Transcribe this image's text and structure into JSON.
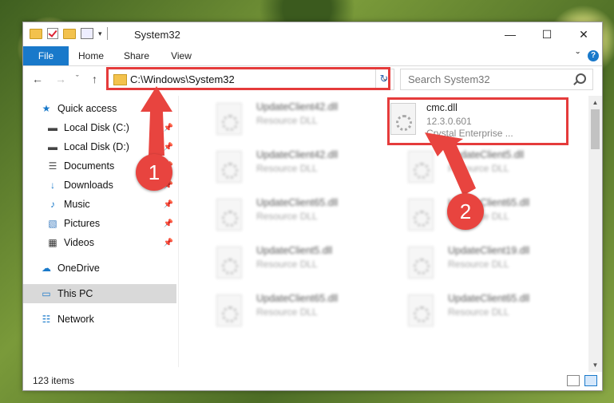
{
  "window": {
    "title": "System32",
    "minimize_glyph": "—",
    "maximize_glyph": "☐",
    "close_glyph": "✕"
  },
  "ribbon": {
    "tabs": [
      "File",
      "Home",
      "Share",
      "View"
    ],
    "expand_glyph": "ˇ",
    "help_glyph": "?"
  },
  "nav": {
    "back_glyph": "←",
    "forward_glyph": "→",
    "recent_glyph": "ˇ",
    "up_glyph": "↑",
    "address": "C:\\Windows\\System32",
    "refresh_glyph": "↻",
    "search_placeholder": "Search System32"
  },
  "sidebar": {
    "items": [
      {
        "label": "Quick access",
        "icon": "star-icon",
        "glyph": "★",
        "pinned": false
      },
      {
        "label": "Local Disk (C:)",
        "icon": "drive-icon",
        "glyph": "▬",
        "pinned": true
      },
      {
        "label": "Local Disk (D:)",
        "icon": "drive-icon",
        "glyph": "▬",
        "pinned": true
      },
      {
        "label": "Documents",
        "icon": "documents-icon",
        "glyph": "☰",
        "pinned": true
      },
      {
        "label": "Downloads",
        "icon": "downloads-icon",
        "glyph": "↓",
        "pinned": true
      },
      {
        "label": "Music",
        "icon": "music-icon",
        "glyph": "♪",
        "pinned": true
      },
      {
        "label": "Pictures",
        "icon": "pictures-icon",
        "glyph": "▧",
        "pinned": true
      },
      {
        "label": "Videos",
        "icon": "videos-icon",
        "glyph": "▦",
        "pinned": true
      },
      {
        "label": "OneDrive",
        "icon": "cloud-icon",
        "glyph": "☁",
        "pinned": false
      },
      {
        "label": "This PC",
        "icon": "computer-icon",
        "glyph": "▭",
        "pinned": false,
        "selected": true
      },
      {
        "label": "Network",
        "icon": "network-icon",
        "glyph": "☷",
        "pinned": false
      }
    ],
    "pin_glyph": "📌"
  },
  "files": [
    {
      "name": "UpdateClient42.dll",
      "type": "Resource DLL"
    },
    {
      "name": "cmc.dll",
      "version": "12.3.0.601",
      "description": "Crystal Enterprise ...",
      "highlighted": true
    },
    {
      "name": "UpdateClient42.dll",
      "type": "Resource DLL"
    },
    {
      "name": "UpdateClient5.dll",
      "type": "Resource DLL"
    },
    {
      "name": "UpdateClient65.dll",
      "type": "Resource DLL"
    },
    {
      "name": "UpdateClient65.dll",
      "type": "Resource DLL"
    },
    {
      "name": "UpdateClient5.dll",
      "type": "Resource DLL"
    },
    {
      "name": "UpdateClient19.dll",
      "type": "Resource DLL"
    },
    {
      "name": "UpdateClient65.dll",
      "type": "Resource DLL"
    },
    {
      "name": "UpdateClient65.dll",
      "type": "Resource DLL"
    }
  ],
  "status": {
    "item_count": "123 items"
  },
  "annotations": {
    "step1": "1",
    "step2": "2",
    "color": "#e53b3b"
  }
}
